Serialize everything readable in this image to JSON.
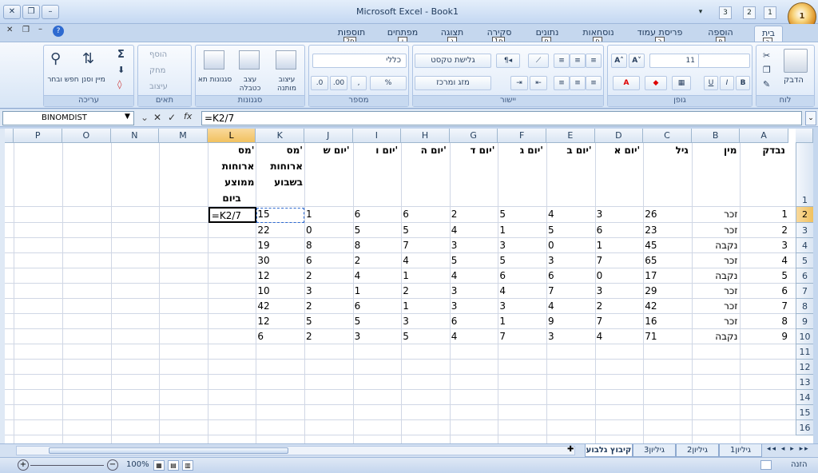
{
  "window": {
    "title": "Microsoft Excel - Book1",
    "office_button_label": "1",
    "qat": [
      "1",
      "2",
      "3"
    ]
  },
  "ribbon_tabs": [
    {
      "label": "בית",
      "key": "ב"
    },
    {
      "label": "הוספה",
      "key": "פ"
    },
    {
      "label": "פריסת עמוד",
      "key": "ר"
    },
    {
      "label": "נוסחאות",
      "key": "ח"
    },
    {
      "label": "נתונים",
      "key": "ם"
    },
    {
      "label": "סקירה",
      "key": "1ס"
    },
    {
      "label": "תצוגה",
      "key": "ג"
    },
    {
      "label": "מפתחים",
      "key": "ו"
    },
    {
      "label": "תוספות",
      "key": "2ס"
    }
  ],
  "ribbon": {
    "groups": [
      "לוח",
      "גופן",
      "יישור",
      "מספר",
      "סגנונות",
      "תאים",
      "עריכה"
    ],
    "paste_label": "הדבק",
    "font_size": "11",
    "wrap_text": "גלישת טקסט",
    "merge_center": "מזג ומרכז",
    "number_format": "כללי",
    "conditional_format": "עיצוב מותנה",
    "format_table": "עצב כטבלה",
    "cell_styles": "סגנונות תא",
    "insert_cells": "הוסף",
    "delete_cells": "מחק",
    "format_cells": "עיצוב",
    "sort_filter": "מיין וסנן",
    "find_select": "חפש ובחר"
  },
  "formula_bar": {
    "name_box": "BINOMDIST",
    "formula": "=K2/7"
  },
  "columns": [
    "A",
    "B",
    "C",
    "D",
    "E",
    "F",
    "G",
    "H",
    "I",
    "J",
    "K",
    "L",
    "M",
    "N",
    "O",
    "P"
  ],
  "header_row": {
    "A": "נבדק",
    "B": "מין",
    "C": "גיל",
    "D": "יום א'",
    "E": "יום ב'",
    "F": "יום ג'",
    "G": "יום ד'",
    "H": "יום ה'",
    "I": "יום ו'",
    "J": "יום ש'",
    "K": [
      "מס'",
      "ארוחות",
      "בשבוע"
    ],
    "L": [
      "מס'",
      "ארוחות",
      "ממוצע",
      "ביום"
    ]
  },
  "rows": [
    {
      "A": "1",
      "B": "זכר",
      "C": "26",
      "D": "3",
      "E": "4",
      "F": "5",
      "G": "2",
      "H": "6",
      "I": "6",
      "J": "1",
      "K": "15"
    },
    {
      "A": "2",
      "B": "זכר",
      "C": "23",
      "D": "6",
      "E": "5",
      "F": "1",
      "G": "4",
      "H": "5",
      "I": "5",
      "J": "0",
      "K": "22"
    },
    {
      "A": "3",
      "B": "נקבה",
      "C": "45",
      "D": "1",
      "E": "0",
      "F": "3",
      "G": "3",
      "H": "7",
      "I": "8",
      "J": "8",
      "K": "19"
    },
    {
      "A": "4",
      "B": "זכר",
      "C": "65",
      "D": "7",
      "E": "3",
      "F": "5",
      "G": "5",
      "H": "4",
      "I": "2",
      "J": "6",
      "K": "30"
    },
    {
      "A": "5",
      "B": "נקבה",
      "C": "17",
      "D": "0",
      "E": "6",
      "F": "6",
      "G": "4",
      "H": "1",
      "I": "4",
      "J": "2",
      "K": "12"
    },
    {
      "A": "6",
      "B": "זכר",
      "C": "29",
      "D": "3",
      "E": "7",
      "F": "4",
      "G": "3",
      "H": "2",
      "I": "1",
      "J": "3",
      "K": "10"
    },
    {
      "A": "7",
      "B": "זכר",
      "C": "42",
      "D": "2",
      "E": "4",
      "F": "3",
      "G": "3",
      "H": "1",
      "I": "6",
      "J": "2",
      "K": "42"
    },
    {
      "A": "8",
      "B": "זכר",
      "C": "16",
      "D": "7",
      "E": "9",
      "F": "1",
      "G": "6",
      "H": "3",
      "I": "5",
      "J": "5",
      "K": "12"
    },
    {
      "A": "9",
      "B": "נקבה",
      "C": "71",
      "D": "4",
      "E": "3",
      "F": "7",
      "G": "4",
      "H": "5",
      "I": "3",
      "J": "2",
      "K": "6"
    }
  ],
  "active_cell_text": "=K2/7",
  "row_numbers": [
    "1",
    "2",
    "3",
    "4",
    "5",
    "6",
    "7",
    "8",
    "9",
    "10",
    "11",
    "12",
    "13",
    "14",
    "15",
    "16"
  ],
  "sheet_tabs": [
    "קיבוץ גלבוע",
    "גיליון3",
    "גיליון2",
    "גיליון1"
  ],
  "status": {
    "mode": "הזנה",
    "zoom": "100%"
  }
}
